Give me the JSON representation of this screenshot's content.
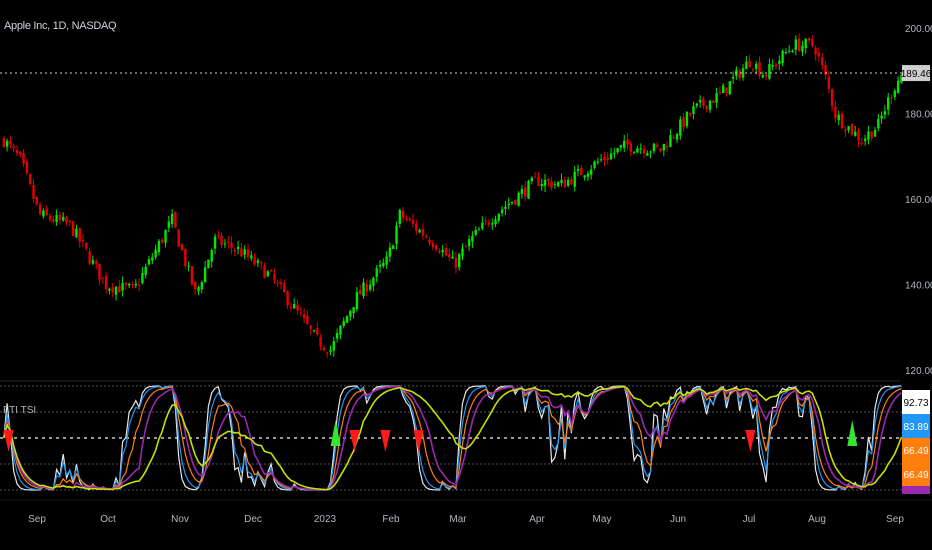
{
  "header": {
    "symbol_title": "Apple Inc, 1D, NASDAQ"
  },
  "indicator": {
    "label": "FTI TSI"
  },
  "chart_data": [
    {
      "type": "candlestick",
      "title": "Apple Inc, 1D, NASDAQ",
      "ylim": [
        120,
        200
      ],
      "y_ticks": [
        "200.00",
        "180.00",
        "160.00",
        "140.00",
        "120.00"
      ],
      "last_price": "189.46",
      "x_ticks": [
        "Sep",
        "Oct",
        "Nov",
        "Dec",
        "2023",
        "Feb",
        "Mar",
        "Apr",
        "May",
        "Jun",
        "Jul",
        "Aug",
        "Sep"
      ],
      "grid": false,
      "colors": {
        "up": "#00e600",
        "down": "#e60000",
        "last_price_line": "#cfcfcf",
        "last_price_badge": "#cfcfcf"
      },
      "close_keypoints": [
        {
          "date": "2022-08-18",
          "close": 173.8
        },
        {
          "date": "2022-08-25",
          "close": 169.1
        },
        {
          "date": "2022-09-02",
          "close": 156.3
        },
        {
          "date": "2022-09-15",
          "close": 153.9
        },
        {
          "date": "2022-09-30",
          "close": 139.9
        },
        {
          "date": "2022-10-12",
          "close": 138.7
        },
        {
          "date": "2022-10-28",
          "close": 155.1
        },
        {
          "date": "2022-11-07",
          "close": 137.5
        },
        {
          "date": "2022-11-15",
          "close": 150.4
        },
        {
          "date": "2022-11-25",
          "close": 148.1
        },
        {
          "date": "2022-12-08",
          "close": 142.2
        },
        {
          "date": "2022-12-16",
          "close": 136.4
        },
        {
          "date": "2022-12-28",
          "close": 127.0
        },
        {
          "date": "2023-01-03",
          "close": 124.7
        },
        {
          "date": "2023-01-13",
          "close": 136.4
        },
        {
          "date": "2023-01-27",
          "close": 145.7
        },
        {
          "date": "2023-02-01",
          "close": 156.3
        },
        {
          "date": "2023-02-17",
          "close": 149.2
        },
        {
          "date": "2023-02-24",
          "close": 144.6
        },
        {
          "date": "2023-03-03",
          "close": 150.4
        },
        {
          "date": "2023-03-13",
          "close": 156.3
        },
        {
          "date": "2023-03-31",
          "close": 164.4
        },
        {
          "date": "2023-04-10",
          "close": 163.3
        },
        {
          "date": "2023-04-27",
          "close": 169.1
        },
        {
          "date": "2023-05-08",
          "close": 172.6
        },
        {
          "date": "2023-05-22",
          "close": 171.5
        },
        {
          "date": "2023-06-05",
          "close": 180.8
        },
        {
          "date": "2023-06-16",
          "close": 184.3
        },
        {
          "date": "2023-06-29",
          "close": 192.5
        },
        {
          "date": "2023-07-05",
          "close": 189.0
        },
        {
          "date": "2023-07-17",
          "close": 196.0
        },
        {
          "date": "2023-07-26",
          "close": 196.0
        },
        {
          "date": "2023-07-31",
          "close": 187.8
        },
        {
          "date": "2023-08-04",
          "close": 179.6
        },
        {
          "date": "2023-08-15",
          "close": 173.8
        },
        {
          "date": "2023-08-22",
          "close": 177.3
        },
        {
          "date": "2023-08-28",
          "close": 185.5
        },
        {
          "date": "2023-09-01",
          "close": 189.46
        }
      ]
    },
    {
      "type": "line",
      "title": "FTI TSI",
      "ylim": [
        0,
        100
      ],
      "levels": [
        100,
        75,
        50,
        25,
        0
      ],
      "series": [
        {
          "color": "#e8e8e8",
          "last_value": "92.73"
        },
        {
          "color": "#2196f3",
          "last_value": "83.89"
        },
        {
          "color": "#ff7f0e",
          "last_value": "66.49"
        },
        {
          "color": "#9c27b0",
          "last_value": ""
        },
        {
          "color": "#c6e000",
          "last_value": ""
        }
      ],
      "badges": [
        {
          "value": "92.73",
          "bg": "#ffffff",
          "fg": "#000000"
        },
        {
          "value": "83.89",
          "bg": "#2196f3",
          "fg": "#ffffff"
        },
        {
          "value": "66.49",
          "bg": "#ff7f0e",
          "fg": "#ffffff"
        }
      ],
      "signals": [
        {
          "date": "2022-08-20",
          "type": "sell",
          "color": "#ff1a1a"
        },
        {
          "date": "2023-01-05",
          "type": "buy",
          "color": "#33e633"
        },
        {
          "date": "2023-01-13",
          "type": "sell",
          "color": "#ff1a1a"
        },
        {
          "date": "2023-01-26",
          "type": "sell",
          "color": "#ff1a1a"
        },
        {
          "date": "2023-02-09",
          "type": "sell",
          "color": "#ff1a1a"
        },
        {
          "date": "2023-06-29",
          "type": "sell",
          "color": "#ff1a1a"
        },
        {
          "date": "2023-08-11",
          "type": "buy",
          "color": "#33e633"
        }
      ]
    }
  ]
}
